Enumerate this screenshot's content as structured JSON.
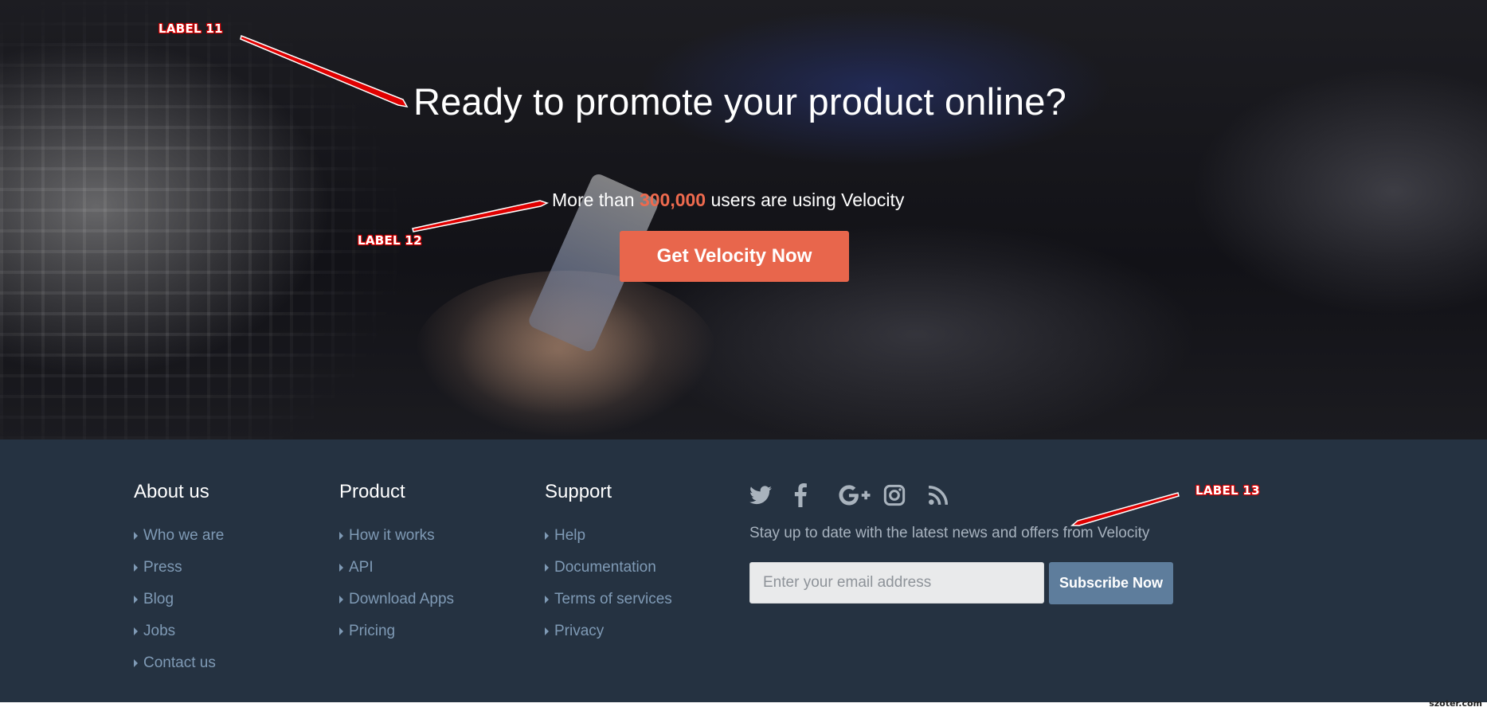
{
  "hero": {
    "title": "Ready to promote your product online?",
    "subtitle_prefix": "More than ",
    "subtitle_highlight": "300,000",
    "subtitle_suffix": " users are using Velocity",
    "cta_label": "Get Velocity Now"
  },
  "annotations": {
    "label_11": "LABEL 11",
    "label_12": "LABEL 12",
    "label_13": "LABEL 13"
  },
  "footer": {
    "columns": [
      {
        "heading": "About us",
        "links": [
          "Who we are",
          "Press",
          "Blog",
          "Jobs",
          "Contact us"
        ]
      },
      {
        "heading": "Product",
        "links": [
          "How it works",
          "API",
          "Download Apps",
          "Pricing"
        ]
      },
      {
        "heading": "Support",
        "links": [
          "Help",
          "Documentation",
          "Terms of services",
          "Privacy"
        ]
      }
    ],
    "social_icons": [
      "twitter-icon",
      "facebook-icon",
      "google-plus-icon",
      "instagram-icon",
      "rss-icon"
    ],
    "newsletter_text": "Stay up to date with the latest news and offers from Velocity",
    "email_placeholder": "Enter your email address",
    "subscribe_label": "Subscribe Now"
  },
  "watermark": "szoter.com",
  "colors": {
    "accent": "#e8664c",
    "highlight": "#ee6a4e",
    "footer_bg": "#253241",
    "link": "#7f9ab5",
    "subscribe_bg": "#5e7d9c",
    "annotation_red": "#e00000"
  }
}
